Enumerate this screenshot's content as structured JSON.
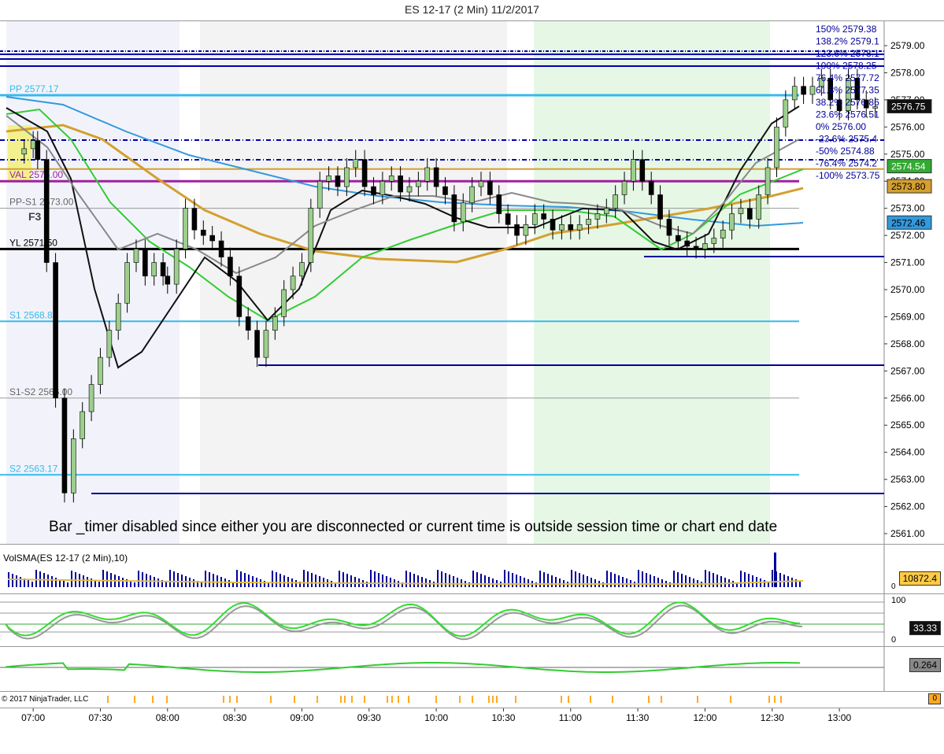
{
  "window_title": "ES 12-17 (2 Min)  11/2/2017",
  "main_panel": {
    "y_ticks": [
      "2579.00",
      "2578.00",
      "2577.00",
      "2576.00",
      "2575.00",
      "2574.00",
      "2573.00",
      "2572.00",
      "2571.00",
      "2570.00",
      "2569.00",
      "2568.00",
      "2567.00",
      "2566.00",
      "2565.00",
      "2564.00",
      "2563.00",
      "2562.00",
      "2561.00"
    ],
    "last_price": "2576.75",
    "ema_value": "2574.54",
    "sma_value": "2573.80",
    "blue_ma_value": "2572.46",
    "level_labels": {
      "pp": "PP 2577.17",
      "val": "VAL 2574.00",
      "pp_s1": "PP-S1 2573.00",
      "yl": "YL 2571.50",
      "s1": "S1 2568.83",
      "s1_s2": "S1-S2 2566.00",
      "s2": "S2 2563.17",
      "f3": "F3"
    },
    "fib_labels": [
      "150%  2579.38",
      "138.2%  2579.1",
      "123.6%  2578.1",
      "100%  2578.25",
      "76.4%  2577.72",
      "61.8%  2577.35",
      "38.2%  2576.86",
      "23.6%  2576.51",
      "0%  2576.00",
      "-23.6%  2575.4",
      "-50%  2574.88",
      "-76.4%  2574.2",
      "-100%  2573.75"
    ],
    "message": "Bar _timer disabled since either you are disconnected or current time is outside session time or chart end date"
  },
  "volume_panel": {
    "label": "VolSMA(ES 12-17 (2 Min),10)",
    "value": "10872.4",
    "axis_zero": "0"
  },
  "stoch_panel": {
    "ticks": [
      "100",
      "0"
    ],
    "value": "33.33"
  },
  "macd_panel": {
    "value": "0.264"
  },
  "bottom_panel": {
    "copyright": "© 2017 NinjaTrader, LLC",
    "value": "0"
  },
  "x_axis": {
    "labels": [
      "07:00",
      "07:30",
      "08:00",
      "08:30",
      "09:00",
      "09:30",
      "10:00",
      "10:30",
      "11:00",
      "11:30",
      "12:00",
      "12:30",
      "13:00"
    ]
  },
  "colors": {
    "up_candle": "#9ccf8c",
    "down_candle": "#000000",
    "pivot_line": "#33bbee",
    "fib_line": "#0000aa",
    "sma_orange": "#d4a030",
    "ema_green": "#33cc33",
    "ma_blue": "#3399dd",
    "session_green": "#e6f7e6"
  },
  "chart_data": {
    "type": "candlestick",
    "title": "ES 12-17 (2 Min)  11/2/2017",
    "ylim": [
      2560.6,
      2579.6
    ],
    "x_range": [
      "06:48",
      "13:20"
    ],
    "close_path": [
      [
        "06:52",
        2575.0
      ],
      [
        "06:56",
        2575.2
      ],
      [
        "07:00",
        2575.5
      ],
      [
        "07:02",
        2574.8
      ],
      [
        "07:06",
        2571.0
      ],
      [
        "07:10",
        2566.0
      ],
      [
        "07:14",
        2562.5
      ],
      [
        "07:18",
        2564.5
      ],
      [
        "07:22",
        2565.5
      ],
      [
        "07:26",
        2566.5
      ],
      [
        "07:30",
        2567.5
      ],
      [
        "07:34",
        2568.5
      ],
      [
        "07:38",
        2569.5
      ],
      [
        "07:42",
        2571.0
      ],
      [
        "07:46",
        2571.5
      ],
      [
        "07:50",
        2570.5
      ],
      [
        "07:54",
        2571.0
      ],
      [
        "07:58",
        2570.5
      ],
      [
        "08:00",
        2570.2
      ],
      [
        "08:04",
        2571.5
      ],
      [
        "08:08",
        2573.0
      ],
      [
        "08:12",
        2572.2
      ],
      [
        "08:16",
        2572.0
      ],
      [
        "08:20",
        2571.8
      ],
      [
        "08:24",
        2571.2
      ],
      [
        "08:28",
        2570.5
      ],
      [
        "08:32",
        2569.0
      ],
      [
        "08:36",
        2568.5
      ],
      [
        "08:40",
        2567.5
      ],
      [
        "08:44",
        2568.5
      ],
      [
        "08:48",
        2569.0
      ],
      [
        "08:52",
        2570.0
      ],
      [
        "08:56",
        2570.5
      ],
      [
        "09:00",
        2571.0
      ],
      [
        "09:04",
        2573.0
      ],
      [
        "09:08",
        2574.0
      ],
      [
        "09:12",
        2574.2
      ],
      [
        "09:16",
        2573.8
      ],
      [
        "09:20",
        2574.5
      ],
      [
        "09:24",
        2574.8
      ],
      [
        "09:28",
        2573.8
      ],
      [
        "09:32",
        2573.5
      ],
      [
        "09:36",
        2574.0
      ],
      [
        "09:40",
        2574.2
      ],
      [
        "09:44",
        2573.6
      ],
      [
        "09:48",
        2573.8
      ],
      [
        "09:52",
        2574.0
      ],
      [
        "09:56",
        2574.5
      ],
      [
        "10:00",
        2573.8
      ],
      [
        "10:04",
        2573.5
      ],
      [
        "10:08",
        2572.5
      ],
      [
        "10:12",
        2573.2
      ],
      [
        "10:16",
        2573.8
      ],
      [
        "10:20",
        2574.0
      ],
      [
        "10:24",
        2573.5
      ],
      [
        "10:28",
        2572.8
      ],
      [
        "10:32",
        2572.4
      ],
      [
        "10:36",
        2572.0
      ],
      [
        "10:40",
        2572.4
      ],
      [
        "10:44",
        2572.8
      ],
      [
        "10:48",
        2572.6
      ],
      [
        "10:52",
        2572.2
      ],
      [
        "10:56",
        2572.4
      ],
      [
        "11:00",
        2572.2
      ],
      [
        "11:04",
        2572.4
      ],
      [
        "11:08",
        2572.6
      ],
      [
        "11:12",
        2572.8
      ],
      [
        "11:16",
        2573.0
      ],
      [
        "11:20",
        2573.5
      ],
      [
        "11:24",
        2574.0
      ],
      [
        "11:28",
        2574.8
      ],
      [
        "11:32",
        2574.0
      ],
      [
        "11:36",
        2573.5
      ],
      [
        "11:40",
        2572.6
      ],
      [
        "11:44",
        2572.0
      ],
      [
        "11:48",
        2571.8
      ],
      [
        "11:52",
        2571.6
      ],
      [
        "11:56",
        2571.5
      ],
      [
        "12:00",
        2571.7
      ],
      [
        "12:04",
        2571.9
      ],
      [
        "12:08",
        2572.2
      ],
      [
        "12:12",
        2572.8
      ],
      [
        "12:16",
        2573.0
      ],
      [
        "12:20",
        2572.6
      ],
      [
        "12:24",
        2573.5
      ],
      [
        "12:28",
        2574.5
      ],
      [
        "12:32",
        2576.0
      ],
      [
        "12:36",
        2577.0
      ],
      [
        "12:40",
        2577.5
      ],
      [
        "12:44",
        2577.2
      ],
      [
        "12:48",
        2577.5
      ],
      [
        "12:52",
        2577.8
      ],
      [
        "12:56",
        2577.0
      ],
      [
        "13:00",
        2576.6
      ],
      [
        "13:04",
        2577.8
      ],
      [
        "13:08",
        2577.0
      ],
      [
        "13:12",
        2576.7
      ],
      [
        "13:16",
        2576.75
      ]
    ],
    "horizontal_levels": [
      {
        "label": "PP 2577.17",
        "value": 2577.17
      },
      {
        "label": "VAL 2574.00",
        "value": 2574.0
      },
      {
        "label": "PP-S1 2573.00",
        "value": 2573.0
      },
      {
        "label": "YL 2571.50",
        "value": 2571.5
      },
      {
        "label": "S1 2568.83",
        "value": 2568.83
      },
      {
        "label": "S1-S2 2566.00",
        "value": 2566.0
      },
      {
        "label": "S2 2563.17",
        "value": 2563.17
      }
    ],
    "last_price": 2576.75
  }
}
